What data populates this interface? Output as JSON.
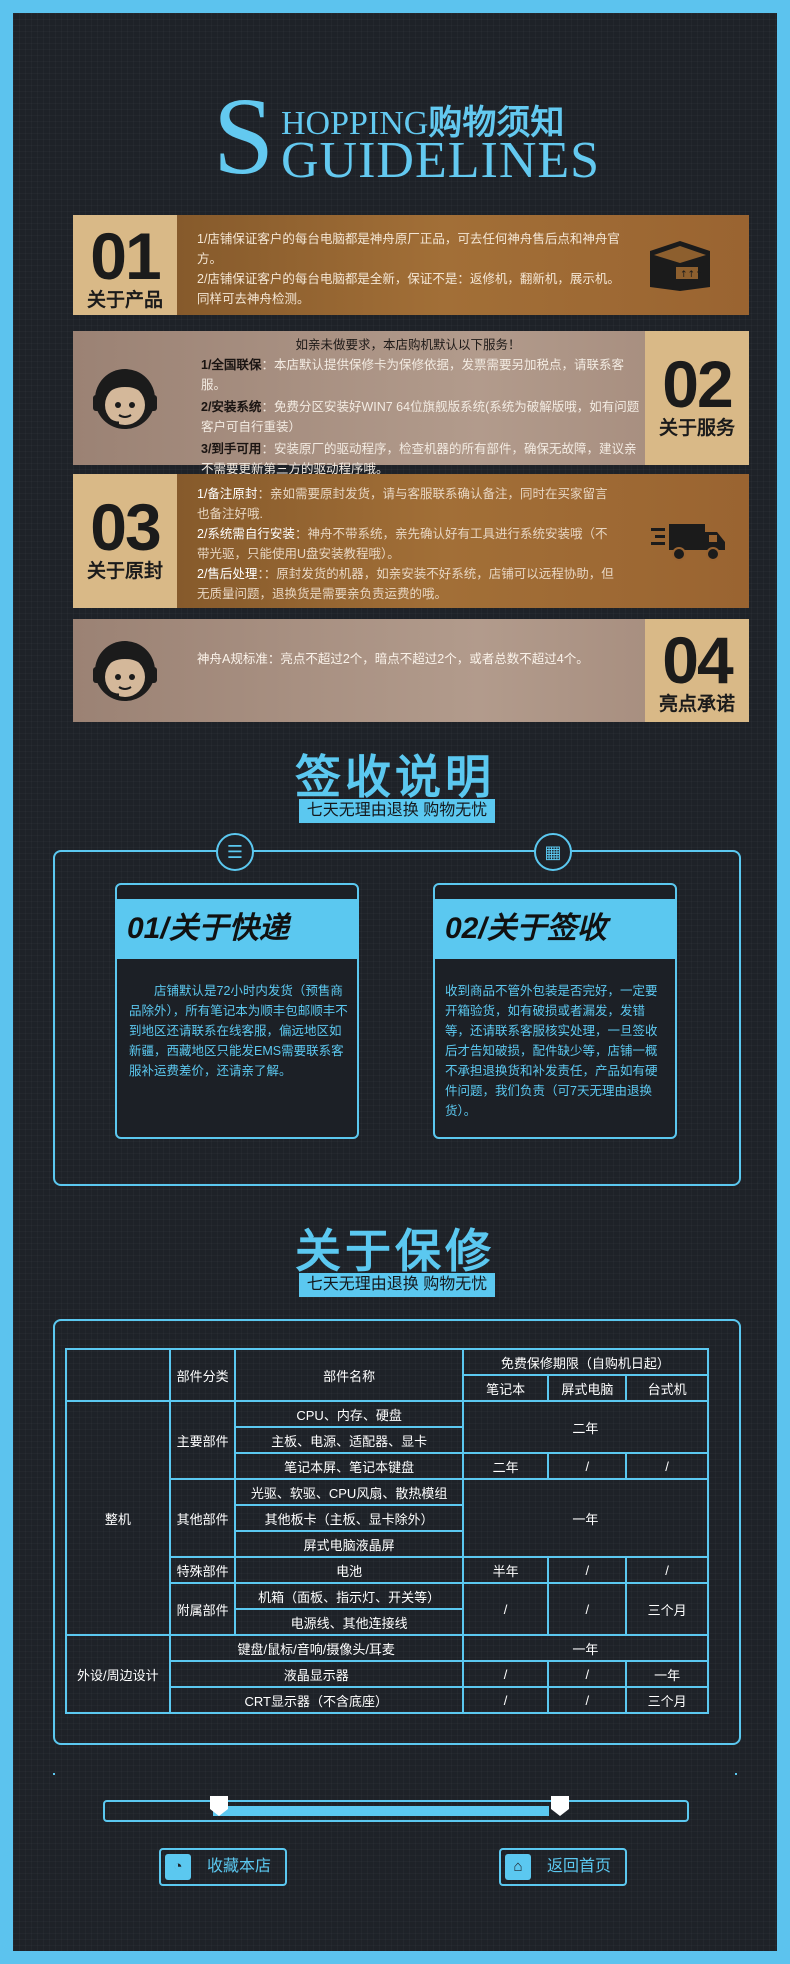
{
  "header": {
    "big_letter": "S",
    "top_word": "HOPPING",
    "top_cn": "购物须知",
    "bottom_word": "GUIDELINES"
  },
  "sections": [
    {
      "num": "01",
      "label": "关于产品",
      "lines": [
        "1/店铺保证客户的每台电脑都是神舟原厂正品，可去任何神舟售后点和神舟官方。",
        "2/店铺保证客户的每台电脑都是全新，保证不是：返修机，翻新机，展示机。同样可去神舟检测。"
      ]
    },
    {
      "num": "02",
      "label": "关于服务",
      "intro": "如亲未做要求，本店购机默认以下服务！",
      "items": [
        {
          "key": "1/全国联保",
          "text": "：本店默认提供保修卡为保修依据，发票需要另加税点，请联系客服。"
        },
        {
          "key": "2/安装系统",
          "text": "：免费分区安装好WIN7 64位旗舰版系统(系统为破解版哦，如有问题客户可自行重装）"
        },
        {
          "key": "3/到手可用",
          "text": "：安装原厂的驱动程序，检查机器的所有部件，确保无故障，建议亲不需要更新第三方的驱动程序哦。"
        }
      ]
    },
    {
      "num": "03",
      "label": "关于原封",
      "items": [
        {
          "key": "1/备注原封",
          "text": "：亲如需要原封发货，请与客服联系确认备注，同时在买家留言也备注好哦."
        },
        {
          "key": "2/系统需自行安装",
          "text": "：神舟不带系统，亲先确认好有工具进行系统安装哦（不带光驱，只能使用U盘安装教程哦）。"
        },
        {
          "key": "2/售后处理",
          "text": "：：原封发货的机器，如亲安装不好系统，店铺可以远程协助，但无质量问题，退换货是需要亲负责运费的哦。"
        }
      ]
    },
    {
      "num": "04",
      "label": "亮点承诺",
      "text": "神舟A规标准：亮点不超过2个，暗点不超过2个，或者总数不超过4个。"
    }
  ],
  "receipt": {
    "title": "签收说明",
    "subtitle": "七天无理由退换 购物无忧",
    "cards": [
      {
        "title": "01/关于快递",
        "body": "店铺默认是72小时内发货（预售商品除外），所有笔记本为顺丰包邮顺丰不到地区还请联系在线客服，偏远地区如新疆，西藏地区只能发EMS需要联系客服补运费差价，还请亲了解。"
      },
      {
        "title": "02/关于签收",
        "body": "收到商品不管外包装是否完好，一定要开箱验货，如有破损或者漏发，发错等，还请联系客服核实处理，一旦签收后才告知破损，配件缺少等，店铺一概不承担退换货和补发责任，产品如有硬件问题，我们负责（可7天无理由退换货）。"
      }
    ]
  },
  "warranty": {
    "title": "关于保修",
    "subtitle": "七天无理由退换 购物无忧",
    "headers": {
      "category": "部件分类",
      "name": "部件名称",
      "period": "免费保修期限（自购机日起）",
      "notebook": "笔记本",
      "desktop_aio": "屏式电脑",
      "desktop": "台式机"
    },
    "group_whole": "整机",
    "group_peripheral": "外设/周边设计",
    "cat_main": "主要部件",
    "cat_other": "其他部件",
    "cat_special": "特殊部件",
    "cat_attach": "附属部件",
    "rows": {
      "r1": "CPU、内存、硬盘",
      "r2": "主板、电源、适配器、显卡",
      "r3": "笔记本屏、笔记本键盘",
      "r4": "光驱、软驱、CPU风扇、散热模组",
      "r5": "其他板卡（主板、显卡除外）",
      "r6": "屏式电脑液晶屏",
      "r7": "电池",
      "r8": "机箱（面板、指示灯、开关等）",
      "r9": "电源线、其他连接线",
      "r10": "键盘/鼠标/音响/摄像头/耳麦",
      "r11": "液晶显示器",
      "r12": "CRT显示器（不含底座）"
    },
    "vals": {
      "two_years": "二年",
      "one_year": "一年",
      "half_year": "半年",
      "slash": "/",
      "three_months": "三个月"
    }
  },
  "footer": {
    "favorite": "收藏本店",
    "home": "返回首页",
    "favorite_icon": "rss-icon",
    "home_icon": "home-icon"
  }
}
